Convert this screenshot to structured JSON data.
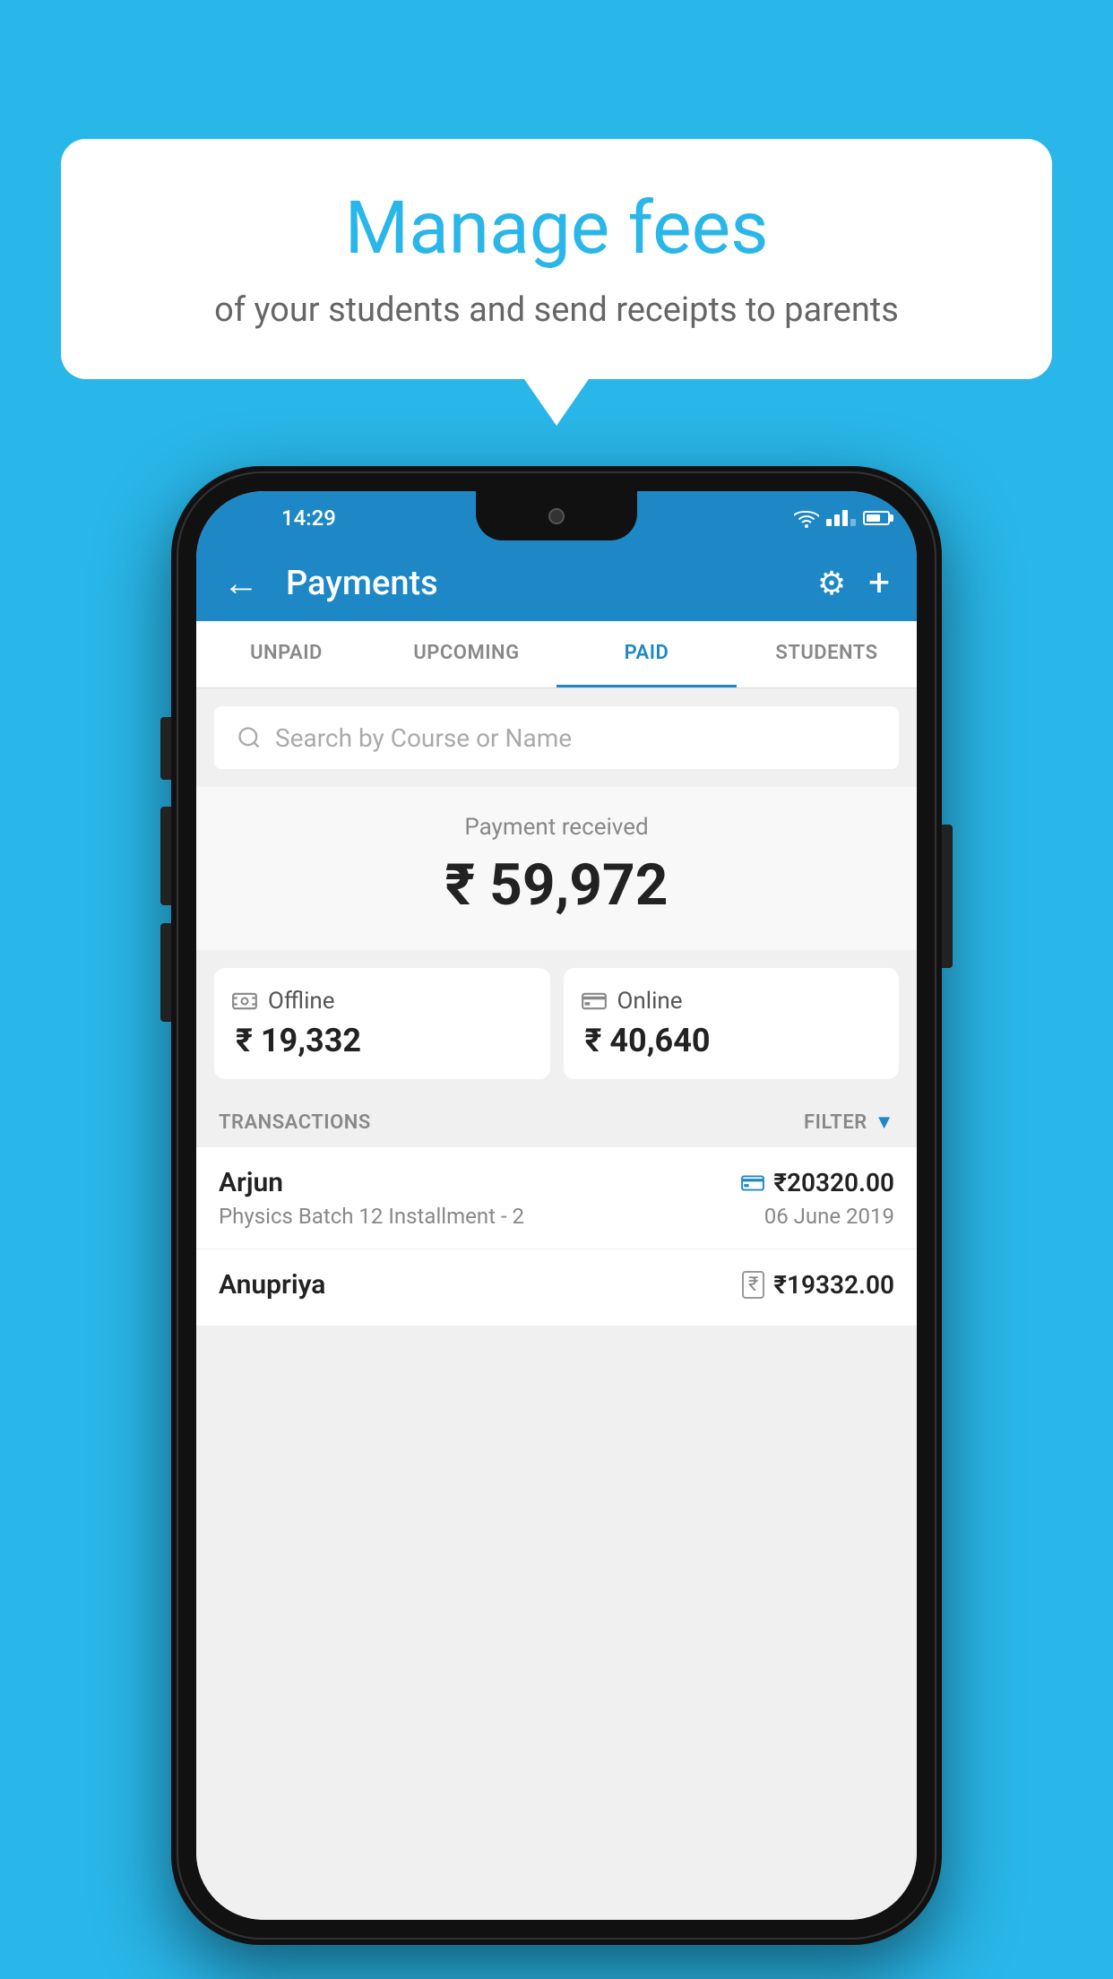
{
  "background_color": "#29B6E8",
  "bubble": {
    "title": "Manage fees",
    "subtitle": "of your students and send receipts to parents"
  },
  "status_bar": {
    "time": "14:29"
  },
  "header": {
    "title": "Payments",
    "back_label": "←",
    "gear_label": "⚙",
    "plus_label": "+"
  },
  "tabs": [
    {
      "label": "UNPAID",
      "active": false
    },
    {
      "label": "UPCOMING",
      "active": false
    },
    {
      "label": "PAID",
      "active": true
    },
    {
      "label": "STUDENTS",
      "active": false
    }
  ],
  "search": {
    "placeholder": "Search by Course or Name"
  },
  "payment": {
    "label": "Payment received",
    "total": "₹ 59,972",
    "offline_label": "Offline",
    "offline_amount": "₹ 19,332",
    "online_label": "Online",
    "online_amount": "₹ 40,640"
  },
  "transactions": {
    "section_label": "TRANSACTIONS",
    "filter_label": "FILTER",
    "rows": [
      {
        "name": "Arjun",
        "amount": "₹20320.00",
        "payment_type": "card",
        "description": "Physics Batch 12 Installment - 2",
        "date": "06 June 2019"
      },
      {
        "name": "Anupriya",
        "amount": "₹19332.00",
        "payment_type": "cash",
        "description": "",
        "date": ""
      }
    ]
  }
}
